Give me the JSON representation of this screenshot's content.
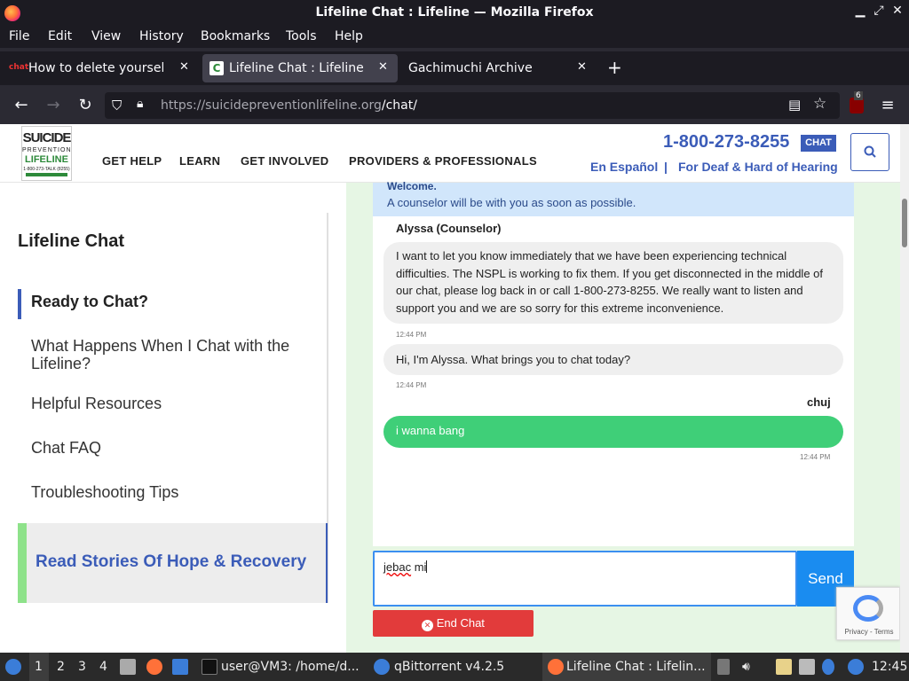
{
  "window": {
    "title": "Lifeline Chat : Lifeline — Mozilla Firefox"
  },
  "menu": [
    "File",
    "Edit",
    "View",
    "History",
    "Bookmarks",
    "Tools",
    "Help"
  ],
  "tabs": [
    {
      "label": "How to delete yourself fr",
      "active": false
    },
    {
      "label": "Lifeline Chat : Lifeline",
      "active": true
    },
    {
      "label": "Gachimuchi Archive",
      "active": false
    }
  ],
  "nav": {
    "url_host": "https://suicidepreventionlifeline.org",
    "url_path": "/chat/",
    "extension_badge": "6"
  },
  "site": {
    "logo": {
      "line1": "SUICIDE",
      "line2": "PREVENTION",
      "line3": "LIFELINE",
      "line4": "1-800-273-TALK (8255)"
    },
    "nav_items": [
      "GET HELP",
      "LEARN",
      "GET INVOLVED",
      "PROVIDERS & PROFESSIONALS"
    ],
    "phone": "1-800-273-8255",
    "chat_badge": "CHAT",
    "espanol": "En Español",
    "separator": "|",
    "deaf": "For Deaf & Hard of Hearing"
  },
  "sidebar": {
    "title": "Lifeline Chat",
    "items": [
      {
        "label": "Ready to Chat?",
        "active": true
      },
      {
        "label": "What Happens When I Chat with the Lifeline?",
        "active": false
      },
      {
        "label": "Helpful Resources",
        "active": false
      },
      {
        "label": "Chat FAQ",
        "active": false
      },
      {
        "label": "Troubleshooting Tips",
        "active": false
      }
    ],
    "stories": "Read Stories Of Hope & Recovery"
  },
  "chat": {
    "welcome_title": "Welcome.",
    "welcome_msg": "A counselor will be with you as soon as possible.",
    "counselor_name": "Alyssa (Counselor)",
    "msg1": "I want to let you know immediately that we have been experiencing technical difficulties. The NSPL is working to fix them. If you get disconnected in the middle of our chat, please log back in or call 1-800-273-8255. We really want to listen and support you and we are so sorry for this extreme inconvenience.",
    "msg1_time": "12:44 PM",
    "msg2": "Hi, I'm Alyssa. What brings you to chat today?",
    "msg2_time": "12:44 PM",
    "user_name": "chuj",
    "msg3": "i wanna bang",
    "msg3_time": "12:44 PM",
    "input_word1": "jebac",
    "input_word2": " mi",
    "send_label": "Send",
    "end_label": "End Chat",
    "recaptcha_text": "Privacy - Terms"
  },
  "taskbar": {
    "workspaces": [
      "1",
      "2",
      "3",
      "4"
    ],
    "tasks": [
      "user@VM3: /home/d...",
      "qBittorrent v4.2.5",
      "Lifeline Chat : Lifelin..."
    ],
    "clock": "12:45"
  }
}
